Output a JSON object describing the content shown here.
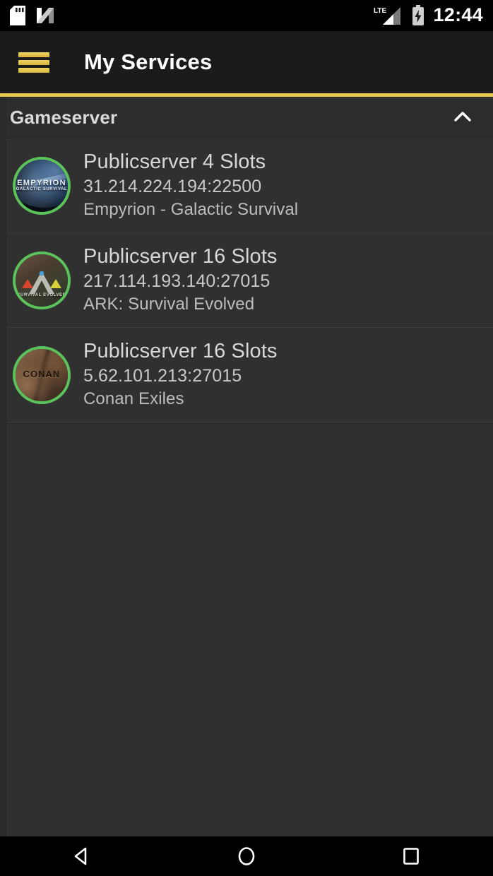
{
  "status_bar": {
    "time": "12:44",
    "left_icons": [
      {
        "name": "sd-card-icon"
      },
      {
        "name": "android-nougat-icon"
      }
    ],
    "right_icons": [
      {
        "name": "lte-signal-icon",
        "label": "LTE"
      },
      {
        "name": "battery-charging-icon"
      }
    ]
  },
  "toolbar": {
    "menu_icon": "hamburger-menu-icon",
    "title": "My Services",
    "accent_color": "#e8c84c"
  },
  "section": {
    "title": "Gameserver",
    "collapse_icon": "chevron-up-icon",
    "expanded": true
  },
  "servers": [
    {
      "title": "Publicserver 4 Slots",
      "address": "31.214.224.194:22500",
      "game": "Empyrion - Galactic Survival",
      "avatar_name": "empyrion-game-icon",
      "avatar_label": "EMPYRION",
      "avatar_sublabel": "GALACTIC SURVIVAL",
      "status_color": "#5cc35c"
    },
    {
      "title": "Publicserver 16 Slots",
      "address": "217.114.193.140:27015",
      "game": "ARK: Survival Evolved",
      "avatar_name": "ark-game-icon",
      "avatar_label": "ARK",
      "avatar_sublabel": "SURVIVAL EVOLVED",
      "status_color": "#5cc35c"
    },
    {
      "title": "Publicserver 16 Slots",
      "address": "5.62.101.213:27015",
      "game": "Conan Exiles",
      "avatar_name": "conan-game-icon",
      "avatar_label": "CONAN",
      "avatar_sublabel": "",
      "status_color": "#5cc35c"
    }
  ],
  "nav_bar": {
    "back": "back-nav-icon",
    "home": "home-nav-icon",
    "recents": "recents-nav-icon"
  }
}
